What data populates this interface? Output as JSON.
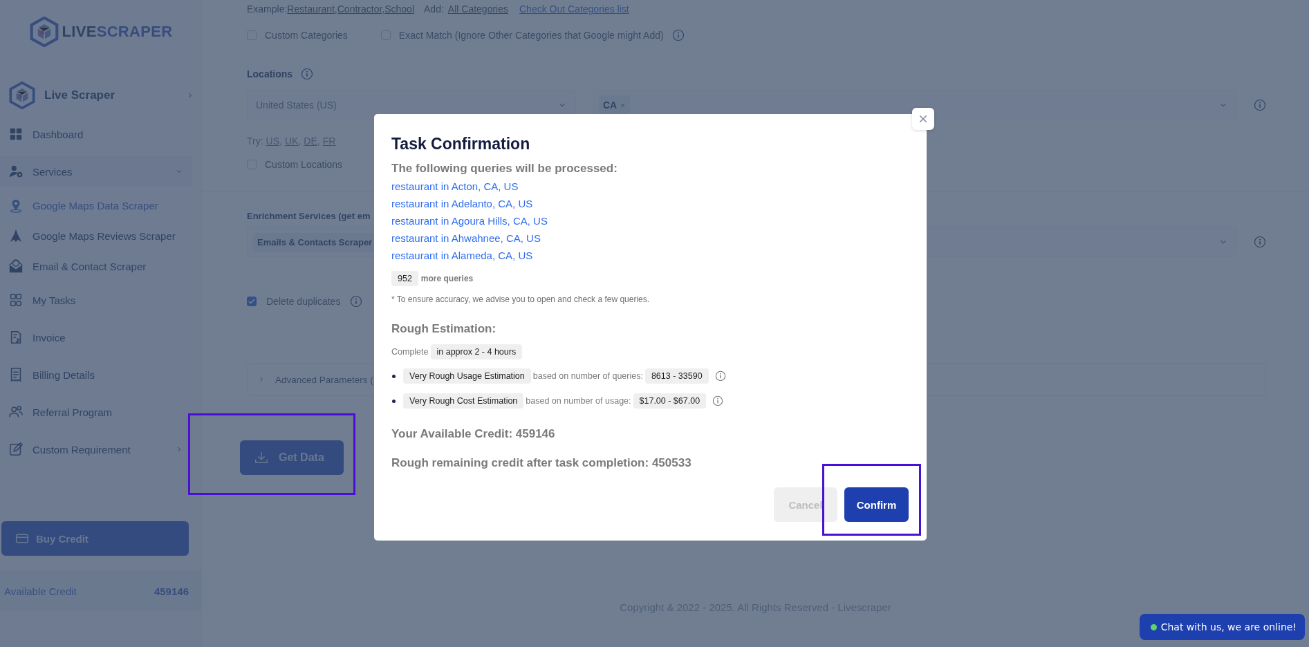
{
  "sidebar": {
    "logo": {
      "part_1": "LIVE",
      "part_2": "SCRAPER"
    },
    "workspace": {
      "label": "Live Scraper"
    },
    "nav": [
      {
        "label": "Dashboard",
        "kind": "link",
        "selected": false
      },
      {
        "label": "Services",
        "kind": "group",
        "expanded": true,
        "selected": false,
        "children": [
          {
            "label": "Google Maps Data Scraper",
            "selected": true
          },
          {
            "label": "Google Maps Reviews Scraper",
            "selected": false
          },
          {
            "label": "Email & Contact Scraper",
            "selected": false
          }
        ]
      },
      {
        "label": "My Tasks",
        "kind": "link",
        "selected": false
      },
      {
        "label": "Invoice",
        "kind": "link",
        "selected": false
      },
      {
        "label": "Billing Details",
        "kind": "link",
        "selected": false
      },
      {
        "label": "Referral Program",
        "kind": "link",
        "selected": false
      },
      {
        "label": "Custom Requirement",
        "kind": "group",
        "expanded": false,
        "selected": false
      }
    ],
    "buy_credit": "Buy Credit",
    "available_credit": {
      "label": "Available Credit",
      "value": "459146"
    }
  },
  "form": {
    "example_line": {
      "prefix": "Example:",
      "examples_link": "Restaurant,Contractor,School",
      "add_label": "Add:",
      "add_link": "All Categories",
      "categories_link": "Check Out Categories list"
    },
    "options": [
      {
        "label": "Custom Categories",
        "checked": false,
        "info": false
      },
      {
        "label": "Exact Match (Ignore Other Categories that Google might Add)",
        "checked": false,
        "info": true
      }
    ],
    "locations": {
      "label": "Locations",
      "country": "United States (US)",
      "states": [
        "CA"
      ],
      "try_label": "Try:",
      "try_links": [
        "US",
        "UK",
        "DE",
        "FR"
      ],
      "try_separator": ",",
      "custom": {
        "label": "Custom Locations",
        "checked": false
      }
    },
    "enrichment": {
      "label": "Enrichment Services (get em",
      "chips": [
        "Emails & Contacts Scraper"
      ]
    },
    "delete_duplicates": {
      "label": "Delete duplicates",
      "checked": true
    },
    "advanced": {
      "label": "Advanced Parameters (",
      "expanded": false
    },
    "get_data": {
      "label": "Get Data",
      "highlighted": true
    }
  },
  "footer": "Copyright & 2022 - 2025. All Rights Reserved -  Livescraper",
  "chat": {
    "label": "Chat with us, we are online!",
    "online": true
  },
  "modal": {
    "title": "Task Confirmation",
    "subtitle": "The following queries will be processed:",
    "queries": [
      "restaurant in Acton, CA, US",
      "restaurant in Adelanto, CA, US",
      "restaurant in Agoura Hills, CA, US",
      "restaurant in Ahwahnee, CA, US",
      "restaurant in Alameda, CA, US"
    ],
    "more_count": "952",
    "more_label": "more queries",
    "note": "* To ensure accuracy, we advise you to open and check a few queries.",
    "estimation_title": "Rough Estimation:",
    "complete_label": "Complete",
    "complete_value": "in approx 2 - 4 hours",
    "estimates": [
      {
        "name": "Very Rough Usage Estimation",
        "basis": "based on number of queries:",
        "range": "8613 - 33590"
      },
      {
        "name": "Very Rough Cost Estimation",
        "basis": "based on number of usage:",
        "range": "$17.00 - $67.00"
      }
    ],
    "available": "Your Available Credit: 459146",
    "remaining": "Rough remaining credit after task completion: 450533",
    "cancel": {
      "label": "Cancel",
      "disabled": true
    },
    "confirm": {
      "label": "Confirm",
      "highlighted": true
    }
  }
}
